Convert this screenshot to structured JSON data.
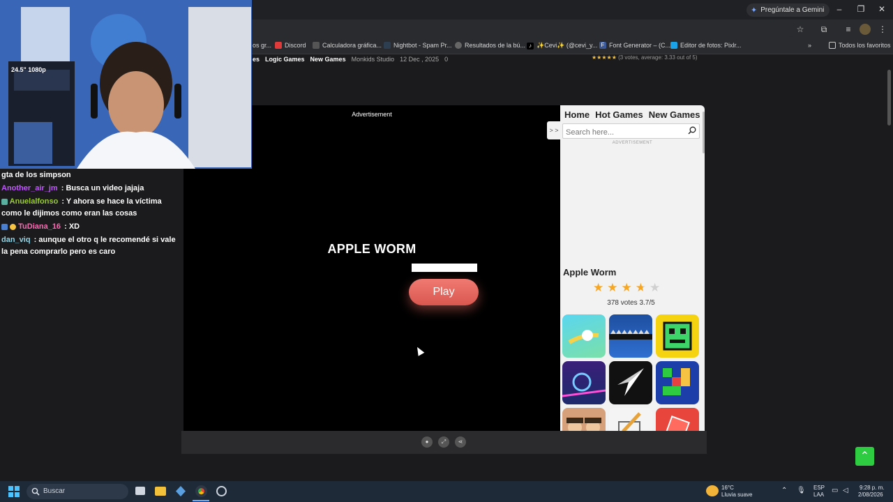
{
  "browser": {
    "gemini_label": "Pregúntale a Gemini",
    "bookmarks": [
      {
        "label": "os gr...",
        "icon": "bookmark-icon",
        "color": "#555555"
      },
      {
        "label": "Discord",
        "icon": "discord-icon",
        "color": "#5865f2"
      },
      {
        "label": "Calculadora gráfica...",
        "icon": "calculator-icon",
        "color": "#555555"
      },
      {
        "label": "Nightbot - Spam Pr...",
        "icon": "nightbot-icon",
        "color": "#2d3e50"
      },
      {
        "label": "Resultados de la bú...",
        "icon": "globe-icon",
        "color": "#666666"
      },
      {
        "label": "✨Cevi✨ (@cevi_y...",
        "icon": "tiktok-icon",
        "color": "#000000"
      },
      {
        "label": "Font Generator – (C...",
        "icon": "font-icon",
        "color": "#3b5998"
      },
      {
        "label": "Editor de fotos: Pixlr...",
        "icon": "pixlr-icon",
        "color": "#1aa3e8"
      }
    ],
    "favorites_label": "Todos los favoritos"
  },
  "page": {
    "meta": {
      "nav_links": [
        "es",
        "Logic Games",
        "New Games"
      ],
      "studio": "Monkids Studio",
      "date": "12 Dec , 2025",
      "comments": "0",
      "rating_text": "(3 votes, average: 3.33 out of 5)"
    },
    "game": {
      "ad_label": "Advertisement",
      "title": "APPLE WORM",
      "loading_progress": 1.0,
      "play_label": "Play"
    },
    "sidebar": {
      "toggle_label": "> >",
      "nav": [
        "Home",
        "Hot Games",
        "New Games"
      ],
      "search_placeholder": "Search here...",
      "ad_label": "ADVERTISEMENT",
      "game_name": "Apple Worm",
      "rating": 3.7,
      "votes_text": "378 votes 3.7/5",
      "thumbs": [
        {
          "name": "thumb-ball-game",
          "icon": "ball-icon"
        },
        {
          "name": "thumb-snake-game",
          "icon": "snake-icon"
        },
        {
          "name": "thumb-geometry-dash",
          "icon": "geometry-dash-icon"
        },
        {
          "name": "thumb-neon-ball",
          "icon": "neon-ball-icon"
        },
        {
          "name": "thumb-arrow-game",
          "icon": "arrow-icon"
        },
        {
          "name": "thumb-block-puzzle",
          "icon": "blocks-icon"
        },
        {
          "name": "thumb-people-game",
          "icon": "people-icon"
        },
        {
          "name": "thumb-draw-game",
          "icon": "pencil-icon"
        },
        {
          "name": "thumb-2048-cube",
          "icon": "cube-icon"
        }
      ]
    }
  },
  "stream": {
    "webcam_badge": "24.5\" 1080p",
    "chat": [
      {
        "user": "",
        "text": "gta de los simpson",
        "color": "#ffffff"
      },
      {
        "user": "Another_air_jm",
        "text": " : Busca un video jajaja",
        "color": "#c055ff"
      },
      {
        "user": "Anuelalfonso",
        "text": " : Y ahora se hace la víctima como le dijimos como eran las cosas",
        "color": "#9acd32"
      },
      {
        "user": "TuDiana_16",
        "text": " : XD",
        "color": "#ff69b4"
      },
      {
        "user": "dan_viq",
        "text": " : aunque el otro q le recomendé si vale la pena comprarlo pero es caro",
        "color": "#8fd6e8"
      }
    ]
  },
  "taskbar": {
    "search_label": "Buscar",
    "weather_temp": "16°C",
    "weather_desc": "Lluvia suave",
    "lang_top": "ESP",
    "lang_bottom": "LAA",
    "time": "9:28 p. m.",
    "date": "2/08/2026"
  }
}
